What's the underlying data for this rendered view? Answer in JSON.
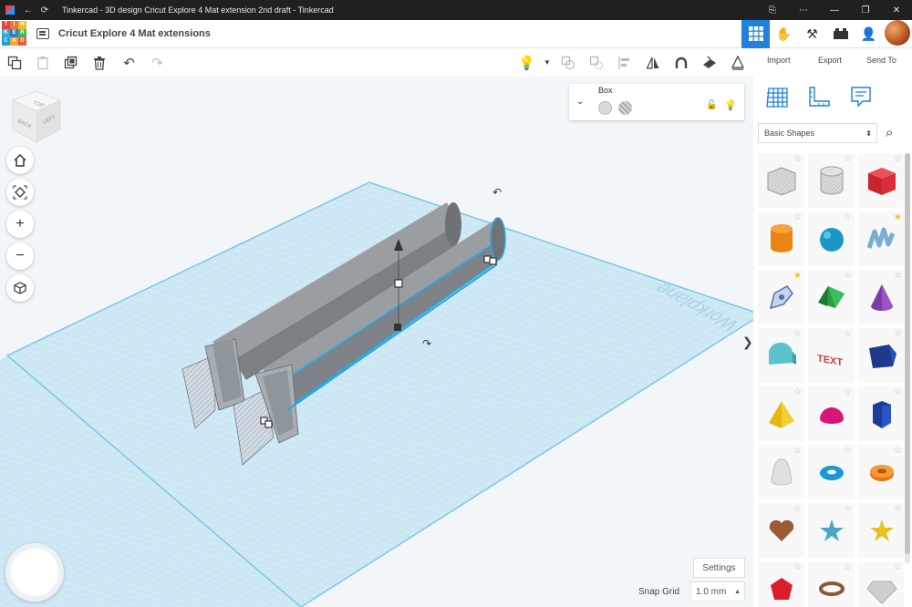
{
  "window": {
    "title": "Tinkercad - 3D design Cricut Explore 4 Mat extension 2nd draft - Tinkercad",
    "back_icon": "arrow-left-icon",
    "reload_icon": "reload-icon",
    "controls": [
      "minimize",
      "maximize",
      "close"
    ]
  },
  "app": {
    "logo_letters": [
      "T",
      "I",
      "N",
      "K",
      "E",
      "R",
      "C",
      "A",
      "D"
    ],
    "project_title": "Cricut Explore 4 Mat extensions",
    "modes": [
      "grid-view-icon",
      "hand-icon",
      "pickaxe-icon",
      "bricks-icon"
    ],
    "active_mode": "grid-view-icon"
  },
  "toolbar": {
    "tools": [
      "copy-icon",
      "paste-icon",
      "duplicate-icon",
      "trash-icon",
      "undo-icon",
      "redo-icon"
    ],
    "right_tools": [
      "light-bulb-icon",
      "group-icon",
      "ungroup-icon",
      "align-icon",
      "flip-icon",
      "magnet-icon",
      "workplane-icon",
      "ruler-icon"
    ],
    "import_label": "Import",
    "export_label": "Export",
    "send_to_label": "Send To"
  },
  "viewcube": {
    "top": "TOP",
    "front": "BACK",
    "right": "LEFT"
  },
  "nav": {
    "home": "home-icon",
    "fit": "fit-view-icon",
    "zoom_in": "zoom-in-icon",
    "zoom_out": "zoom-out-icon",
    "perspective": "cube-perspective-icon"
  },
  "inspector": {
    "title": "Box",
    "solid_label": "solid-color-swatch",
    "hole_label": "hole-swatch"
  },
  "workplane": {
    "label": "Workplane"
  },
  "bottom": {
    "settings_label": "Settings",
    "snap_grid_label": "Snap Grid",
    "snap_grid_value": "1.0 mm"
  },
  "sidebar": {
    "panel_icons": [
      "workplane-grid-icon",
      "ruler-panel-icon",
      "notes-icon"
    ],
    "category": "Basic Shapes",
    "colors": {
      "accent": "#1f80dd",
      "favorite": "#f3c51c"
    },
    "shapes": [
      {
        "name": "box-hole",
        "fav": false
      },
      {
        "name": "cylinder-hole",
        "fav": false
      },
      {
        "name": "box",
        "fav": false
      },
      {
        "name": "cylinder",
        "fav": false
      },
      {
        "name": "sphere",
        "fav": false
      },
      {
        "name": "scribble",
        "fav": true
      },
      {
        "name": "shape-generator-pen",
        "fav": true
      },
      {
        "name": "roof",
        "fav": false
      },
      {
        "name": "cone",
        "fav": false
      },
      {
        "name": "round-roof",
        "fav": false
      },
      {
        "name": "text",
        "fav": false
      },
      {
        "name": "polygon",
        "fav": false
      },
      {
        "name": "pyramid",
        "fav": false
      },
      {
        "name": "half-sphere",
        "fav": false
      },
      {
        "name": "hexagonal-prism",
        "fav": false
      },
      {
        "name": "paraboloid",
        "fav": false
      },
      {
        "name": "torus",
        "fav": false
      },
      {
        "name": "tube",
        "fav": false
      },
      {
        "name": "heart",
        "fav": false
      },
      {
        "name": "star",
        "fav": false
      },
      {
        "name": "star-yellow",
        "fav": false
      },
      {
        "name": "icosahedron",
        "fav": false
      },
      {
        "name": "ring",
        "fav": false
      },
      {
        "name": "diamond",
        "fav": false
      }
    ],
    "shape_text_label": "TEXT"
  }
}
